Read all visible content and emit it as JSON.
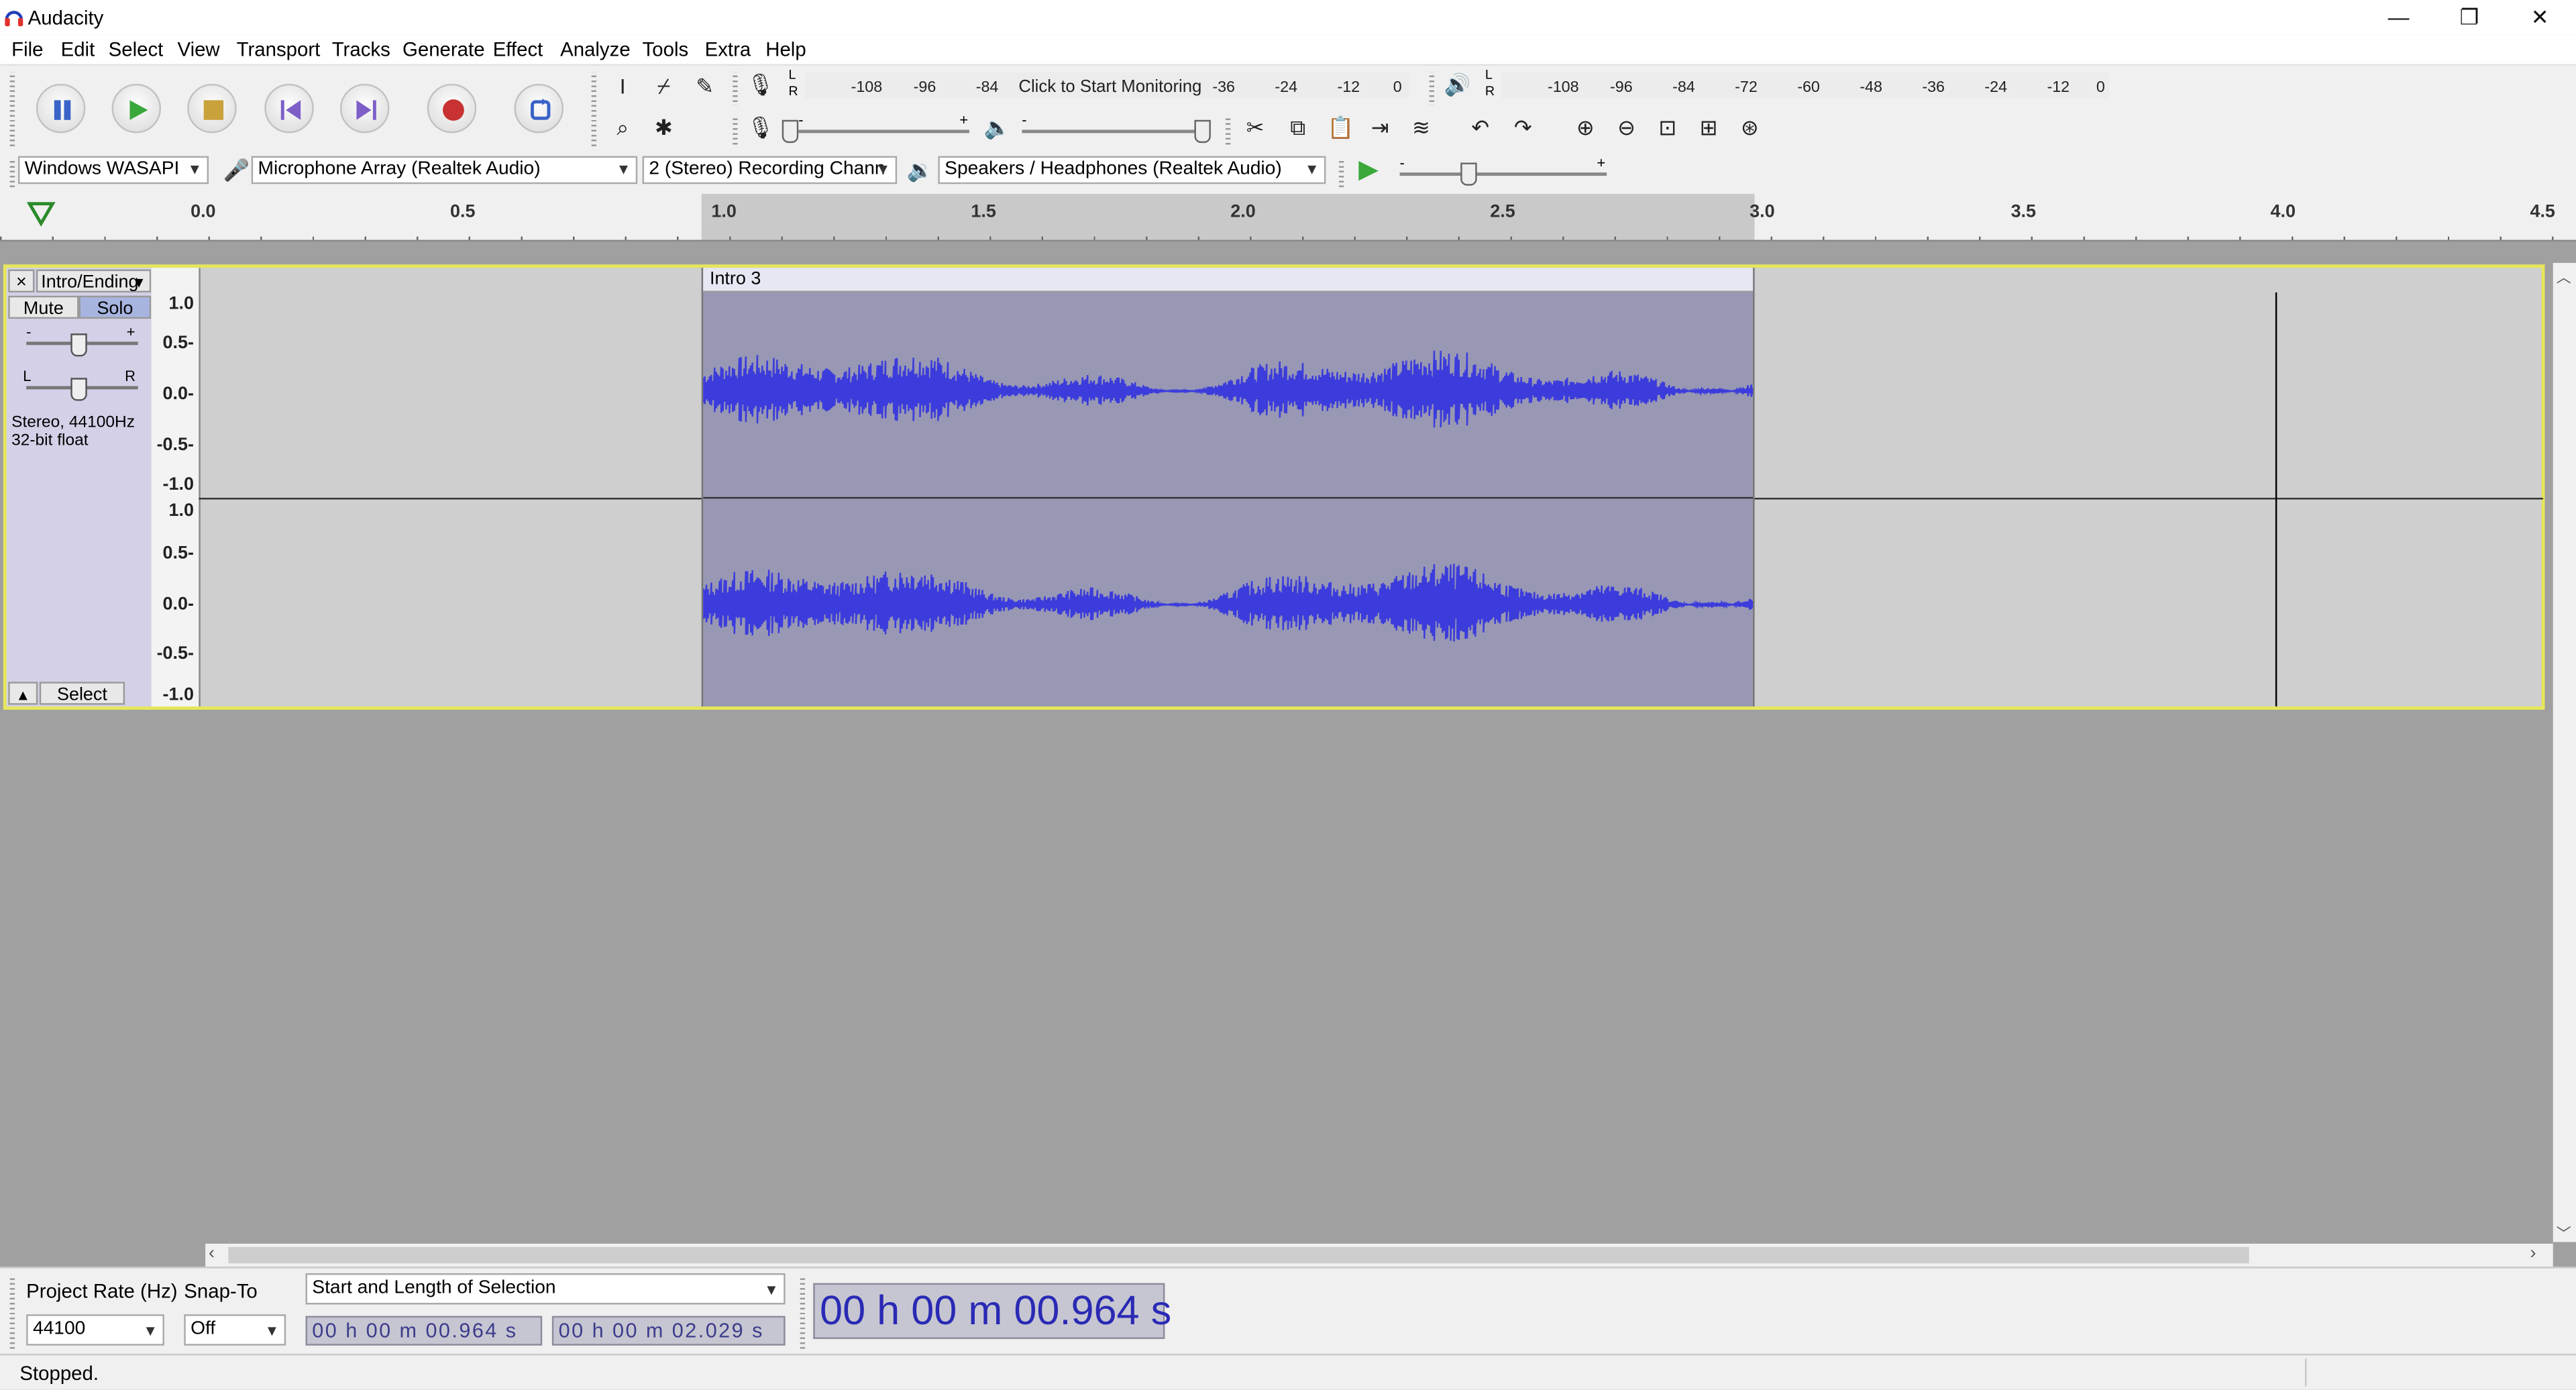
{
  "window": {
    "title": "Audacity",
    "minimize": "—",
    "maximize": "❐",
    "close": "✕"
  },
  "menu": [
    "File",
    "Edit",
    "Select",
    "View",
    "Transport",
    "Tracks",
    "Generate",
    "Effect",
    "Analyze",
    "Tools",
    "Extra",
    "Help"
  ],
  "colors": {
    "accent_play": "#3aa83a",
    "record": "#c83232",
    "waveform": "#3c3cdc",
    "selection_clip": "#9898b4",
    "track_focus": "#e6e65a",
    "time_text": "#2a2ab5"
  },
  "transport": {
    "pause": "pause-icon",
    "play": "play-icon",
    "stop": "stop-icon",
    "skip_start": "skip-to-start-icon",
    "skip_end": "skip-to-end-icon",
    "record": "record-icon",
    "loop": "loop-icon"
  },
  "meters": {
    "record": {
      "lr": [
        "L",
        "R"
      ],
      "scale": [
        "-108",
        "-96",
        "-84",
        "-36",
        "-24",
        "-12",
        "0"
      ],
      "prompt": "Click to Start Monitoring"
    },
    "playback": {
      "lr": [
        "L",
        "R"
      ],
      "scale": [
        "-108",
        "-96",
        "-84",
        "-72",
        "-60",
        "-48",
        "-36",
        "-24",
        "-12",
        "0"
      ]
    }
  },
  "mixer": {
    "minus": "-",
    "plus": "+"
  },
  "devices": {
    "host": "Windows WASAPI",
    "mic": "Microphone Array (Realtek Audio)",
    "channels": "2 (Stereo) Recording Chann",
    "speakers": "Speakers / Headphones (Realtek Audio)",
    "speed_minus": "-",
    "speed_plus": "+"
  },
  "ruler": {
    "labels": [
      "0.0",
      "0.5",
      "1.0",
      "1.5",
      "2.0",
      "2.5",
      "3.0",
      "3.5",
      "4.0",
      "4.5"
    ]
  },
  "track": {
    "close": "×",
    "name": "Intro/Ending",
    "mute": "Mute",
    "solo": "Solo",
    "gain_minus": "-",
    "gain_plus": "+",
    "pan_l": "L",
    "pan_r": "R",
    "info_line1": "Stereo, 44100Hz",
    "info_line2": "32-bit float",
    "select": "Select",
    "vruler": [
      "1.0",
      "0.5-",
      "0.0-",
      "-0.5-",
      "-1.0",
      "1.0",
      "0.5-",
      "0.0-",
      "-0.5-",
      "-1.0"
    ],
    "clip_name": "Intro 3"
  },
  "selection": {
    "project_rate_label": "Project Rate (Hz)",
    "snap_label": "Snap-To",
    "mode": "Start and Length of Selection",
    "rate": "44100",
    "snap": "Off",
    "start": "00 h 00 m 00.964 s",
    "length": "00 h 00 m 02.029 s",
    "audio_position": "00 h 00 m 00.964 s"
  },
  "status": {
    "text": "Stopped."
  }
}
